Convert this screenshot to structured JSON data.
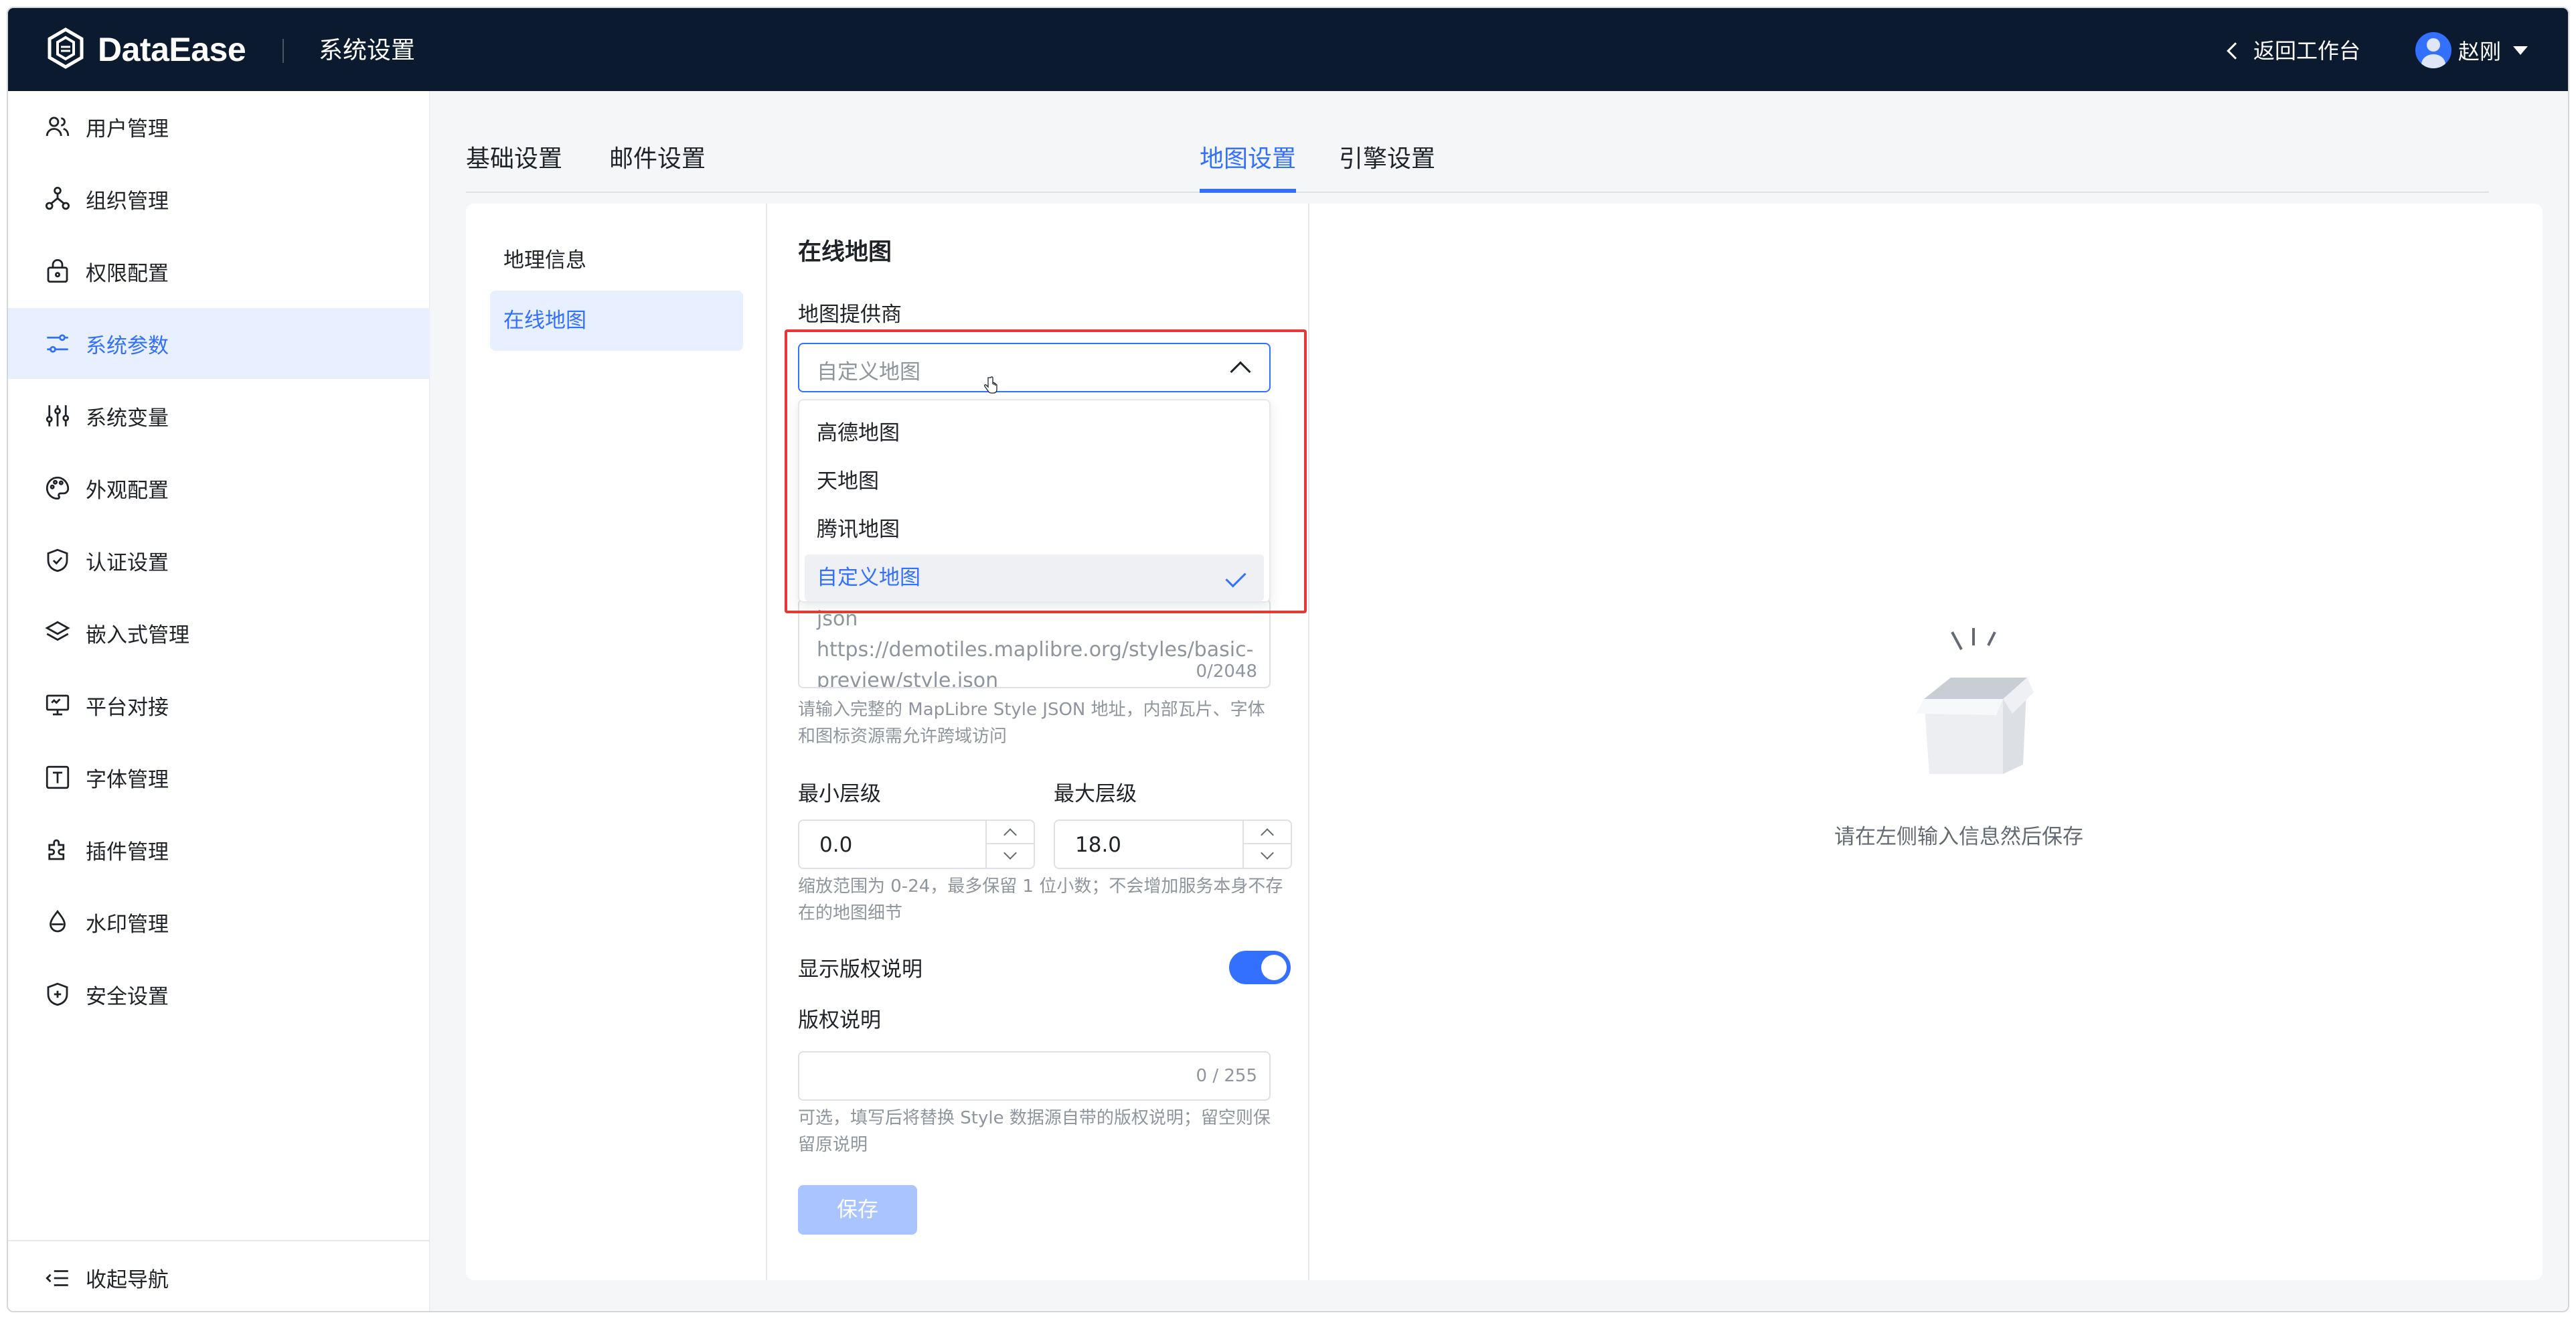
{
  "header": {
    "brand": "DataEase",
    "title": "系统设置",
    "back_label": "返回工作台",
    "user_name": "赵刚"
  },
  "sidebar": {
    "items": [
      {
        "label": "用户管理",
        "icon": "users-icon"
      },
      {
        "label": "组织管理",
        "icon": "org-icon"
      },
      {
        "label": "权限配置",
        "icon": "lock-icon"
      },
      {
        "label": "系统参数",
        "icon": "sliders-icon",
        "active": true
      },
      {
        "label": "系统变量",
        "icon": "variable-icon"
      },
      {
        "label": "外观配置",
        "icon": "palette-icon"
      },
      {
        "label": "认证设置",
        "icon": "shield-check-icon"
      },
      {
        "label": "嵌入式管理",
        "icon": "layers-icon"
      },
      {
        "label": "平台对接",
        "icon": "monitor-icon"
      },
      {
        "label": "字体管理",
        "icon": "font-icon"
      },
      {
        "label": "插件管理",
        "icon": "puzzle-icon"
      },
      {
        "label": "水印管理",
        "icon": "drop-icon"
      },
      {
        "label": "安全设置",
        "icon": "shield-plus-icon"
      }
    ],
    "collapse_label": "收起导航"
  },
  "tabs": [
    {
      "label": "基础设置"
    },
    {
      "label": "邮件设置"
    },
    {
      "label": "地图设置",
      "active": true
    },
    {
      "label": "引擎设置"
    }
  ],
  "subnav": [
    {
      "label": "地理信息"
    },
    {
      "label": "在线地图",
      "active": true
    }
  ],
  "form": {
    "section_title": "在线地图",
    "provider_label": "地图提供商",
    "provider_value": "自定义地图",
    "provider_options": [
      "高德地图",
      "天地图",
      "腾讯地图",
      "自定义地图"
    ],
    "style_url_text": "json  https://demotiles.maplibre.org/styles/basic-preview/style.json",
    "style_url_count": "0/2048",
    "style_hint": "请输入完整的 MapLibre Style JSON 地址，内部瓦片、字体和图标资源需允许跨域访问",
    "min_zoom_label": "最小层级",
    "min_zoom_value": "0.0",
    "max_zoom_label": "最大层级",
    "max_zoom_value": "18.0",
    "zoom_hint": "缩放范围为 0-24，最多保留 1 位小数；不会增加服务本身不存在的地图细节",
    "show_copyright_label": "显示版权说明",
    "show_copyright_on": true,
    "copyright_label": "版权说明",
    "copyright_count": "0 / 255",
    "copyright_hint": "可选，填写后将替换 Style 数据源自带的版权说明；留空则保留原说明",
    "save_label": "保存"
  },
  "empty_state": {
    "message": "请在左侧输入信息然后保存"
  },
  "colors": {
    "accent": "#3370ff",
    "header_bg": "#0b1a2e",
    "highlight": "#e53935"
  }
}
